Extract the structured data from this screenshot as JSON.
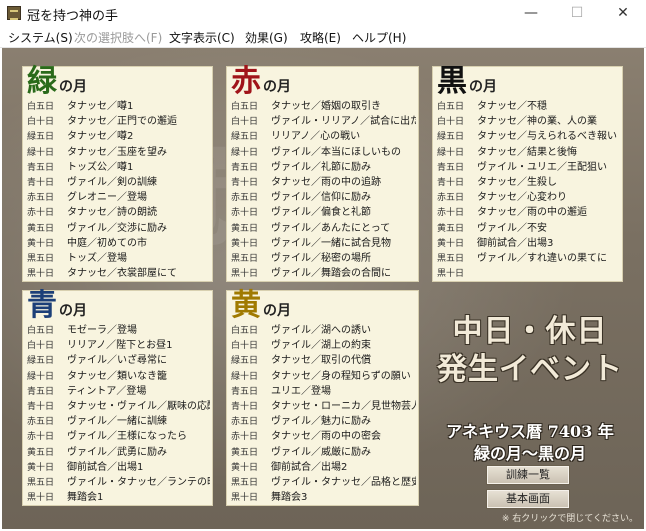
{
  "window": {
    "title": "冠を持つ神の手",
    "minimize": "—",
    "maximize": "☐",
    "close": "✕"
  },
  "menu": [
    {
      "label": "システム(S)",
      "enabled": true
    },
    {
      "label": "次の選択肢へ(F)",
      "enabled": false
    },
    {
      "label": "文字表示(C)",
      "enabled": true
    },
    {
      "label": "効果(G)",
      "enabled": true
    },
    {
      "label": "攻略(E)",
      "enabled": true
    },
    {
      "label": "ヘルプ(H)",
      "enabled": true
    }
  ],
  "month_suffix": "の月",
  "panels": [
    {
      "name": "green",
      "kanji": "緑",
      "color": "#2a6a1a",
      "rows": [
        {
          "day": "白五日",
          "text": "タナッセ／噂1"
        },
        {
          "day": "白十日",
          "text": "タナッセ／正門での邂逅"
        },
        {
          "day": "緑五日",
          "text": "タナッセ／噂2"
        },
        {
          "day": "緑十日",
          "text": "タナッセ／玉座を望み"
        },
        {
          "day": "青五日",
          "text": "トッズ公／噂1"
        },
        {
          "day": "青十日",
          "text": "ヴァイル／剣の訓練"
        },
        {
          "day": "赤五日",
          "text": "グレオニー／登場"
        },
        {
          "day": "赤十日",
          "text": "タナッセ／詩の朗読"
        },
        {
          "day": "黄五日",
          "text": "ヴァイル／交渉に励み"
        },
        {
          "day": "黄十日",
          "text": "中庭／初めての市"
        },
        {
          "day": "黒五日",
          "text": "トッズ／登場"
        },
        {
          "day": "黒十日",
          "text": "タナッセ／衣裳部屋にて"
        }
      ]
    },
    {
      "name": "red",
      "kanji": "赤",
      "color": "#a0141a",
      "rows": [
        {
          "day": "白五日",
          "text": "タナッセ／婚姻の取引き"
        },
        {
          "day": "白十日",
          "text": "ヴァイル・リリアノ／試合に出たい"
        },
        {
          "day": "緑五日",
          "text": "リリアノ／心の戦い"
        },
        {
          "day": "緑十日",
          "text": "ヴァイル／本当にほしいもの"
        },
        {
          "day": "青五日",
          "text": "ヴァイル／礼節に励み"
        },
        {
          "day": "青十日",
          "text": "タナッセ／雨の中の追跡"
        },
        {
          "day": "赤五日",
          "text": "ヴァイル／信仰に励み"
        },
        {
          "day": "赤十日",
          "text": "ヴァイル／偏食と礼節"
        },
        {
          "day": "黄五日",
          "text": "ヴァイル／あんたにとって"
        },
        {
          "day": "黄十日",
          "text": "ヴァイル／一緒に試合見物"
        },
        {
          "day": "黒五日",
          "text": "ヴァイル／秘密の場所"
        },
        {
          "day": "黒十日",
          "text": "ヴァイル／舞踏会の合間に"
        }
      ]
    },
    {
      "name": "black",
      "kanji": "黒",
      "color": "#111111",
      "rows": [
        {
          "day": "白五日",
          "text": "タナッセ／不穏"
        },
        {
          "day": "白十日",
          "text": "タナッセ／神の業、人の業"
        },
        {
          "day": "緑五日",
          "text": "タナッセ／与えられるべき報い"
        },
        {
          "day": "緑十日",
          "text": "タナッセ／結果と後悔"
        },
        {
          "day": "青五日",
          "text": "ヴァイル・ユリエ／王配狙い"
        },
        {
          "day": "青十日",
          "text": "タナッセ／生殺し"
        },
        {
          "day": "赤五日",
          "text": "タナッセ／心変わり"
        },
        {
          "day": "赤十日",
          "text": "タナッセ／雨の中の邂逅"
        },
        {
          "day": "黄五日",
          "text": "ヴァイル／不安"
        },
        {
          "day": "黄十日",
          "text": "御前試合／出場3"
        },
        {
          "day": "黒五日",
          "text": "ヴァイル／すれ違いの果てに"
        },
        {
          "day": "黒十日",
          "text": ""
        }
      ]
    },
    {
      "name": "blue",
      "kanji": "青",
      "color": "#1c3f78",
      "rows": [
        {
          "day": "白五日",
          "text": "モゼーラ／登場"
        },
        {
          "day": "白十日",
          "text": "リリアノ／陛下とお昼1"
        },
        {
          "day": "緑五日",
          "text": "ヴァイル／いざ尋常に"
        },
        {
          "day": "緑十日",
          "text": "タナッセ／類いなき籠"
        },
        {
          "day": "青五日",
          "text": "ティントア／登場"
        },
        {
          "day": "青十日",
          "text": "タナッセ・ヴァイル／厭味の応酬"
        },
        {
          "day": "赤五日",
          "text": "ヴァイル／一緒に訓練"
        },
        {
          "day": "赤十日",
          "text": "ヴァイル／王様になったら"
        },
        {
          "day": "黄五日",
          "text": "ヴァイル／武勇に励み"
        },
        {
          "day": "黄十日",
          "text": "御前試合／出場1"
        },
        {
          "day": "黒五日",
          "text": "ヴァイル・タナッセ／ランテの晩餐"
        },
        {
          "day": "黒十日",
          "text": "舞踏会1"
        }
      ]
    },
    {
      "name": "yellow",
      "kanji": "黄",
      "color": "#a07a00",
      "rows": [
        {
          "day": "白五日",
          "text": "ヴァイル／湖への誘い"
        },
        {
          "day": "白十日",
          "text": "ヴァイル／湖上の約束"
        },
        {
          "day": "緑五日",
          "text": "タナッセ／取引の代償"
        },
        {
          "day": "緑十日",
          "text": "タナッセ／身の程知らずの願い"
        },
        {
          "day": "青五日",
          "text": "ユリエ／登場"
        },
        {
          "day": "青十日",
          "text": "タナッセ・ローニカ／見世物芸人"
        },
        {
          "day": "赤五日",
          "text": "ヴァイル／魅力に励み"
        },
        {
          "day": "赤十日",
          "text": "タナッセ／雨の中の密会"
        },
        {
          "day": "黄五日",
          "text": "ヴァイル／威厳に励み"
        },
        {
          "day": "黄十日",
          "text": "御前試合／出場2"
        },
        {
          "day": "黒五日",
          "text": "ヴァイル・タナッセ／品格と歴史"
        },
        {
          "day": "黒十日",
          "text": "舞踏会3"
        }
      ]
    }
  ],
  "sunday": {
    "line1": "中日・休日",
    "line2": "発生イベント",
    "calendar1": "アネキウス暦 7403 年",
    "calendar2": "緑の月〜黒の月"
  },
  "buttons": {
    "training_list": "訓練一覧",
    "basic_screen": "基本画面"
  },
  "hint": "※ 右クリックで閉じてください。"
}
